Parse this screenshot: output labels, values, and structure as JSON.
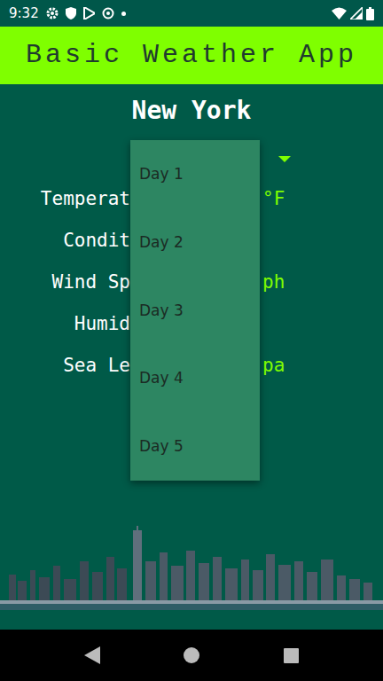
{
  "status_bar": {
    "time": "9:32"
  },
  "app_bar": {
    "title": "Basic Weather App"
  },
  "city": "New York",
  "day_spinner": {
    "expanded": true,
    "options": [
      {
        "label": "Day 1",
        "selected": false
      },
      {
        "label": "Day 2",
        "selected": false
      },
      {
        "label": "Day 3",
        "selected": false
      },
      {
        "label": "Day 4",
        "selected": false
      },
      {
        "label": "Day 5",
        "selected": false
      }
    ]
  },
  "rows": [
    {
      "label": "Temperat",
      "value": "°F"
    },
    {
      "label": "Condit"
    },
    {
      "label": "Wind Sp",
      "value": "ph"
    },
    {
      "label": "Humid"
    },
    {
      "label": "Sea Le",
      "value": "pa"
    }
  ]
}
